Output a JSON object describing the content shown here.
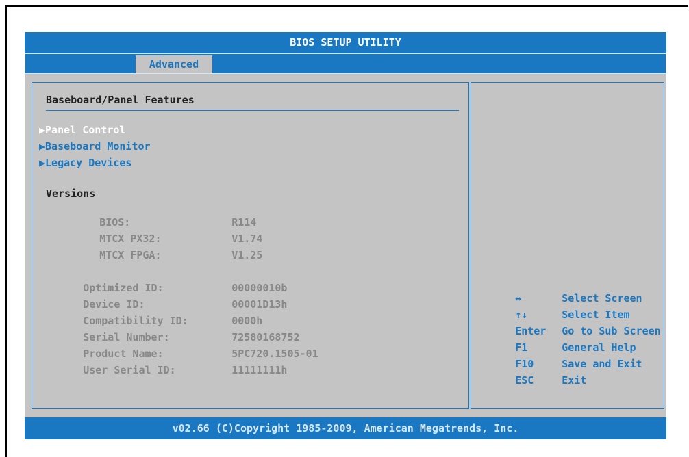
{
  "title_bar": {
    "text": "BIOS SETUP UTILITY"
  },
  "tabs": [
    {
      "label": "Advanced",
      "active": true
    }
  ],
  "main": {
    "section_title": "Baseboard/Panel Features",
    "menu_items": [
      {
        "label": "Panel Control",
        "selected": true
      },
      {
        "label": "Baseboard Monitor",
        "selected": false
      },
      {
        "label": "Legacy Devices",
        "selected": false
      }
    ],
    "submenu_marker": "▶",
    "versions": {
      "heading": "Versions",
      "rows": [
        {
          "label": "BIOS:",
          "value": "R114"
        },
        {
          "label": "MTCX PX32:",
          "value": "V1.74"
        },
        {
          "label": "MTCX FPGA:",
          "value": "V1.25"
        }
      ]
    },
    "info_rows": [
      {
        "label": "Optimized ID:",
        "value": "00000010b"
      },
      {
        "label": "Device ID:",
        "value": "00001D13h"
      },
      {
        "label": "Compatibility ID:",
        "value": "0000h"
      },
      {
        "label": "Serial Number:",
        "value": "72580168752"
      },
      {
        "label": "Product Name:",
        "value": "5PC720.1505-01"
      },
      {
        "label": "User Serial ID:",
        "value": "11111111h"
      }
    ]
  },
  "help": {
    "rows": [
      {
        "key": "↔",
        "desc": "Select Screen",
        "icon": "left-right-arrow-icon"
      },
      {
        "key": "↑↓",
        "desc": "Select Item",
        "icon": "up-down-arrow-icon"
      },
      {
        "key": "Enter",
        "desc": "Go to Sub Screen"
      },
      {
        "key": "F1",
        "desc": "General Help"
      },
      {
        "key": "F10",
        "desc": "Save and Exit"
      },
      {
        "key": "ESC",
        "desc": "Exit"
      }
    ]
  },
  "footer": {
    "text": "v02.66 (C)Copyright 1985-2009, American Megatrends, Inc."
  },
  "colors": {
    "accent_blue": "#1a78c2",
    "panel_gray": "#c4c4c4",
    "dim_text": "#888888",
    "highlight_text": "#ffffff"
  }
}
